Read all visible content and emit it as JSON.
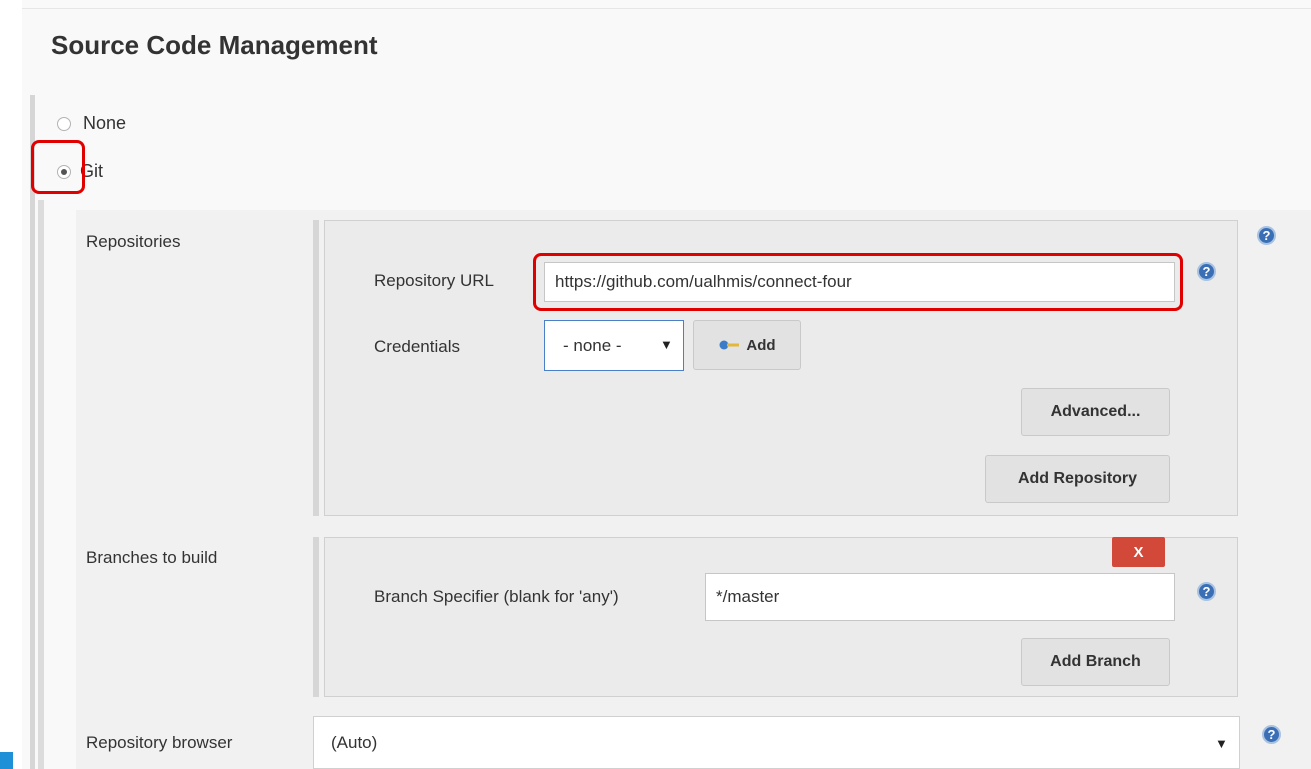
{
  "section": {
    "title": "Source Code Management"
  },
  "scm_options": [
    {
      "label": "None",
      "selected": false
    },
    {
      "label": "Git",
      "selected": true
    }
  ],
  "repositories": {
    "label": "Repositories",
    "url_label": "Repository URL",
    "url_value": "https://github.com/ualhmis/connect-four",
    "credentials_label": "Credentials",
    "credentials_selected": "- none -",
    "add_label": "Add",
    "advanced_label": "Advanced...",
    "add_repository_label": "Add Repository"
  },
  "branches": {
    "label": "Branches to build",
    "delete_label": "X",
    "specifier_label": "Branch Specifier (blank for 'any')",
    "specifier_value": "*/master",
    "add_branch_label": "Add Branch"
  },
  "browser": {
    "label": "Repository browser",
    "selected": "(Auto)"
  },
  "icons": {
    "help": "help-icon",
    "dropdown": "dropdown-arrow-icon",
    "key": "key-icon"
  },
  "colors": {
    "highlight": "#e00000",
    "delete_button": "#d24939",
    "help_icon": "#3a6fb6"
  }
}
